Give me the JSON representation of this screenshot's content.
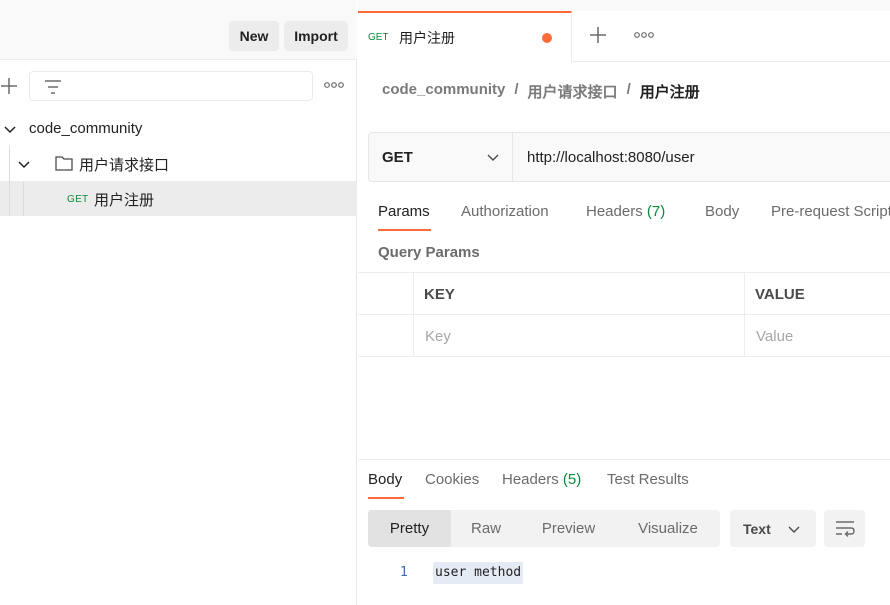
{
  "sidebar": {
    "new_label": "New",
    "import_label": "Import",
    "tree": {
      "collection": "code_community",
      "folder": "用户请求接口",
      "request_method": "GET",
      "request_name": "用户注册"
    }
  },
  "tab": {
    "method": "GET",
    "title": "用户注册"
  },
  "breadcrumb": {
    "collection": "code_community",
    "sep1": "/",
    "folder": "用户请求接口",
    "sep2": "/",
    "request": "用户注册"
  },
  "request": {
    "method": "GET",
    "url": "http://localhost:8080/user",
    "tabs": {
      "params": "Params",
      "authorization": "Authorization",
      "headers": "Headers",
      "headers_count": "(7)",
      "body": "Body",
      "prerequest": "Pre-request Script"
    },
    "query_params_title": "Query Params",
    "table": {
      "key_header": "KEY",
      "value_header": "VALUE",
      "key_placeholder": "Key",
      "value_placeholder": "Value"
    }
  },
  "response": {
    "tabs": {
      "body": "Body",
      "cookies": "Cookies",
      "headers": "Headers",
      "headers_count": "(5)",
      "test_results": "Test Results"
    },
    "views": {
      "pretty": "Pretty",
      "raw": "Raw",
      "preview": "Preview",
      "visualize": "Visualize"
    },
    "format": "Text",
    "line_number": "1",
    "body_text": "user method"
  },
  "colors": {
    "accent": "#ff6c37",
    "get_method": "#0b8a3e"
  }
}
